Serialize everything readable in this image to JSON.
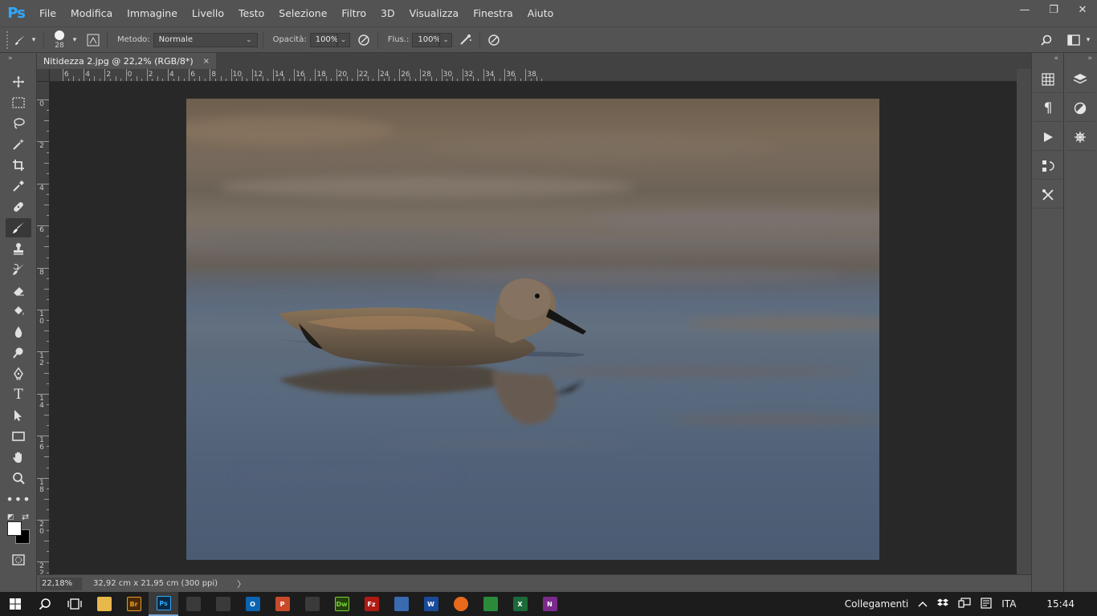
{
  "app": {
    "logo": "Ps",
    "menu": [
      "File",
      "Modifica",
      "Immagine",
      "Livello",
      "Testo",
      "Selezione",
      "Filtro",
      "3D",
      "Visualizza",
      "Finestra",
      "Aiuto"
    ]
  },
  "window_controls": [
    "—",
    "❐",
    "✕"
  ],
  "options_bar": {
    "brush_size": "28",
    "mode_label": "Metodo:",
    "mode_value": "Normale",
    "opacity_label": "Opacità:",
    "opacity_value": "100%",
    "flow_label": "Flus.:",
    "flow_value": "100%"
  },
  "document": {
    "tab_title": "Nitidezza 2.jpg @ 22,2% (RGB/8*)",
    "close_glyph": "×"
  },
  "ruler_h_labels": [
    "6",
    "4",
    "2",
    "0",
    "2",
    "4",
    "6",
    "8",
    "10",
    "12",
    "14",
    "16",
    "18",
    "20",
    "22",
    "24",
    "26",
    "28",
    "30",
    "32",
    "34",
    "36",
    "38"
  ],
  "ruler_v_labels": [
    "0",
    "2",
    "4",
    "6",
    "8",
    "10",
    "12",
    "14",
    "16",
    "18",
    "20",
    "22"
  ],
  "status": {
    "zoom": "22,18%",
    "doc_size": "32,92 cm x 21,95 cm (300 ppi)",
    "arrow": "〉"
  },
  "taskbar": {
    "tray_label": "Collegamenti",
    "language": "ITA",
    "time": "15:44",
    "apps": [
      {
        "name": "explorer",
        "label": "",
        "color": "#e8b84a"
      },
      {
        "name": "bridge",
        "label": "Br",
        "color": "#4a2a05"
      },
      {
        "name": "photoshop",
        "label": "Ps",
        "color": "#0a2a45"
      },
      {
        "name": "camera",
        "label": "",
        "color": "#3a3a3a"
      },
      {
        "name": "paint",
        "label": "",
        "color": "#3a3a3a"
      },
      {
        "name": "outlook",
        "label": "O",
        "color": "#0a64b0"
      },
      {
        "name": "powerpoint",
        "label": "P",
        "color": "#c84a2a"
      },
      {
        "name": "palette",
        "label": "",
        "color": "#3a3a3a"
      },
      {
        "name": "dreamweaver",
        "label": "Dw",
        "color": "#25420a"
      },
      {
        "name": "filezilla",
        "label": "Fz",
        "color": "#b01a12"
      },
      {
        "name": "tool",
        "label": "",
        "color": "#3a6ab0"
      },
      {
        "name": "word",
        "label": "W",
        "color": "#1a4a9a"
      },
      {
        "name": "firefox",
        "label": "",
        "color": "#e86a1a"
      },
      {
        "name": "green-app",
        "label": "",
        "color": "#2a8a3a"
      },
      {
        "name": "excel",
        "label": "X",
        "color": "#1a6a3a"
      },
      {
        "name": "onenote",
        "label": "N",
        "color": "#7a2a8a"
      }
    ]
  }
}
